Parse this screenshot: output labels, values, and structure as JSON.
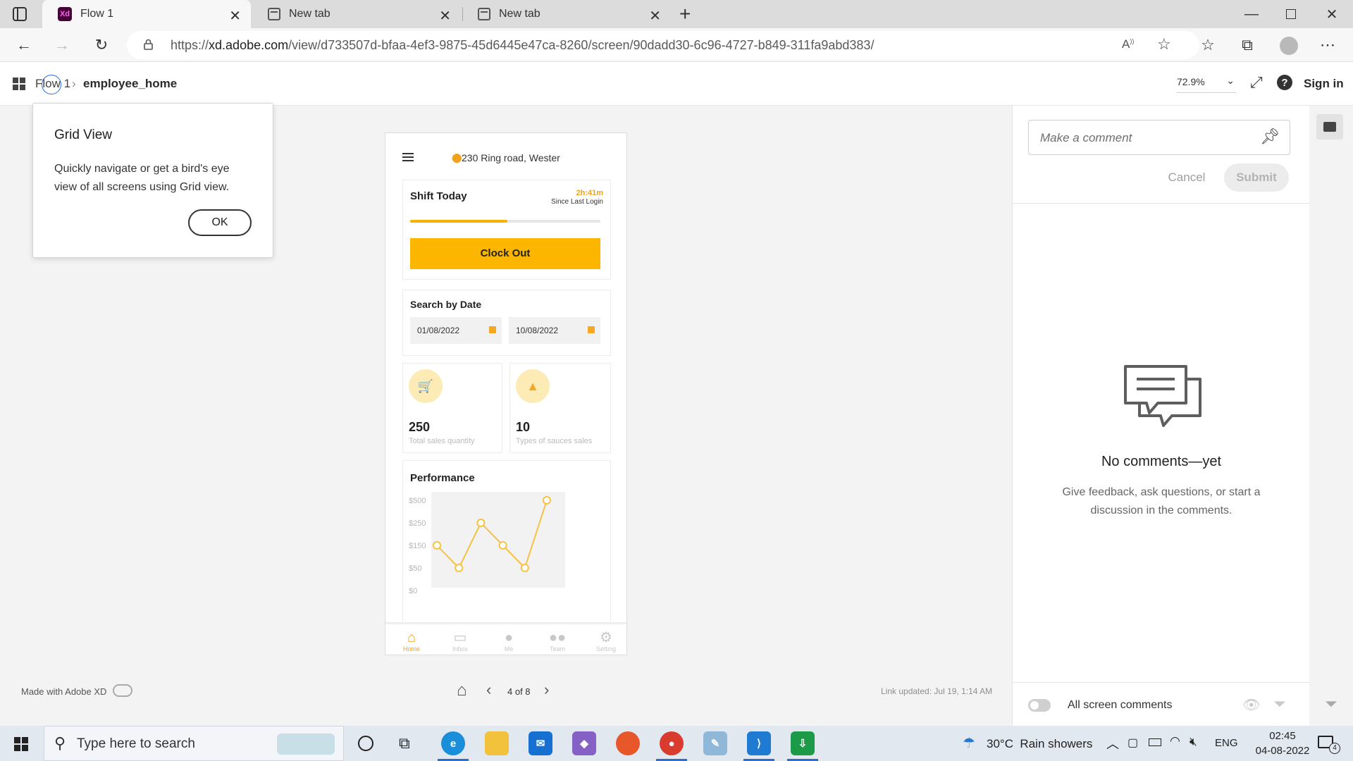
{
  "browser": {
    "tabs": [
      {
        "label": "Flow 1",
        "favicon": "adobe-xd-icon",
        "active": true
      },
      {
        "label": "New tab",
        "favicon": "new-tab-icon",
        "active": false
      },
      {
        "label": "New tab",
        "favicon": "new-tab-icon",
        "active": false
      }
    ],
    "url": "https://xd.adobe.com/view/d733507d-bfaa-4ef3-9875-45d6445e47ca-8260/screen/90dadd30-6c96-4727-b849-311fa9abd383/",
    "url_host": "xd.adobe.com",
    "url_path": "/view/d733507d-bfaa-4ef3-9875-45d6445e47ca-8260/screen/90dadd30-6c96-4727-b849-311fa9abd383/",
    "url_scheme": "https://"
  },
  "xd": {
    "breadcrumb_flow": "Flow 1",
    "breadcrumb_screen": "employee_home",
    "zoom": "72.9%",
    "sign_in": "Sign in",
    "accent": "#f0a11d"
  },
  "dialog": {
    "title": "Grid View",
    "body": "Quickly navigate or get a bird's eye view of all screens using Grid view.",
    "ok": "OK"
  },
  "phone": {
    "location": "230 Ring road, Wester",
    "shift_title": "Shift Today",
    "shift_time": "2h:41m",
    "shift_since": "Since Last Login",
    "shift_progress": 0.51,
    "clock_out": "Clock Out",
    "search_title": "Search by Date",
    "date_from": "01/08/2022",
    "date_to": "10/08/2022",
    "stats": [
      {
        "value": "250",
        "label": "Total sales quantity",
        "icon": "cart-icon"
      },
      {
        "value": "10",
        "label": "Types of sauces sales",
        "icon": "sauce-bottle-icon"
      }
    ],
    "performance_title": "Performance",
    "nav": [
      {
        "label": "Home",
        "icon": "home-icon",
        "active": true
      },
      {
        "label": "Inbox",
        "icon": "inbox-icon",
        "active": false
      },
      {
        "label": "Me",
        "icon": "person-icon",
        "active": false
      },
      {
        "label": "Team",
        "icon": "team-icon",
        "active": false
      },
      {
        "label": "Setting",
        "icon": "gear-icon",
        "active": false
      }
    ]
  },
  "chart_data": {
    "type": "line",
    "title": "Performance",
    "y_tick_labels": [
      "$500",
      "$250",
      "$150",
      "$50",
      "$0"
    ],
    "values": [
      150,
      50,
      250,
      150,
      50,
      500
    ],
    "color": "#f5c342",
    "grid": false
  },
  "footer": {
    "made_with": "Made with Adobe XD",
    "page_indicator": "4 of 8",
    "link_updated": "Link updated: Jul 19, 1:14 AM"
  },
  "comments": {
    "placeholder": "Make a comment",
    "cancel": "Cancel",
    "submit": "Submit",
    "empty_title": "No comments—yet",
    "empty_body": "Give feedback, ask questions, or start a discussion in the comments.",
    "all_screen_comments": "All screen comments"
  },
  "taskbar": {
    "search_placeholder": "Type here to search",
    "weather": "30°C  Rain showers",
    "language": "ENG",
    "time": "02:45",
    "date": "04-08-2022",
    "notifications": "4"
  }
}
